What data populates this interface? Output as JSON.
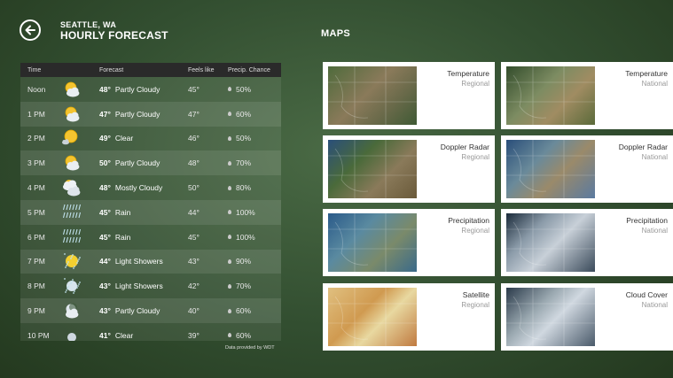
{
  "header": {
    "city": "SEATTLE, WA",
    "title": "HOURLY FORECAST",
    "maps_title": "MAPS"
  },
  "table": {
    "columns": [
      "Time",
      "Forecast",
      "Feels like",
      "Precip. Chance"
    ],
    "rows": [
      {
        "time": "Noon",
        "temp": "48°",
        "condition": "Partly Cloudy",
        "feels": "45°",
        "precip": "50%",
        "icon": "partly-cloudy-icon"
      },
      {
        "time": "1 PM",
        "temp": "47°",
        "condition": "Partly Cloudy",
        "feels": "47°",
        "precip": "60%",
        "icon": "partly-cloudy-icon"
      },
      {
        "time": "2 PM",
        "temp": "49°",
        "condition": "Clear",
        "feels": "46°",
        "precip": "50%",
        "icon": "clear-icon"
      },
      {
        "time": "3 PM",
        "temp": "50°",
        "condition": "Partly Cloudy",
        "feels": "48°",
        "precip": "70%",
        "icon": "partly-cloudy-icon"
      },
      {
        "time": "4 PM",
        "temp": "48°",
        "condition": "Mostly Cloudy",
        "feels": "50°",
        "precip": "80%",
        "icon": "mostly-cloudy-icon"
      },
      {
        "time": "5 PM",
        "temp": "45°",
        "condition": "Rain",
        "feels": "44°",
        "precip": "100%",
        "icon": "rain-icon"
      },
      {
        "time": "6 PM",
        "temp": "45°",
        "condition": "Rain",
        "feels": "45°",
        "precip": "100%",
        "icon": "rain-icon"
      },
      {
        "time": "7 PM",
        "temp": "44°",
        "condition": "Light Showers",
        "feels": "43°",
        "precip": "90%",
        "icon": "light-showers-icon"
      },
      {
        "time": "8 PM",
        "temp": "43°",
        "condition": "Light Showers",
        "feels": "42°",
        "precip": "70%",
        "icon": "light-showers-night-icon"
      },
      {
        "time": "9 PM",
        "temp": "43°",
        "condition": "Partly Cloudy",
        "feels": "40°",
        "precip": "60%",
        "icon": "partly-cloudy-night-icon"
      },
      {
        "time": "10 PM",
        "temp": "41°",
        "condition": "Clear",
        "feels": "39°",
        "precip": "60%",
        "icon": "clear-night-icon"
      }
    ]
  },
  "credit": "Data provided by WDT",
  "maps": [
    {
      "name": "Temperature",
      "scope": "Regional",
      "thumb": "regional-temp"
    },
    {
      "name": "Temperature",
      "scope": "National",
      "thumb": "national-temp"
    },
    {
      "name": "Doppler Radar",
      "scope": "Regional",
      "thumb": "regional-radar"
    },
    {
      "name": "Doppler Radar",
      "scope": "National",
      "thumb": "national-radar"
    },
    {
      "name": "Precipitation",
      "scope": "Regional",
      "thumb": "regional-precip"
    },
    {
      "name": "Precipitation",
      "scope": "National",
      "thumb": "national-precip"
    },
    {
      "name": "Satellite",
      "scope": "Regional",
      "thumb": "regional-satellite"
    },
    {
      "name": "Cloud Cover",
      "scope": "National",
      "thumb": "national-cloud"
    }
  ]
}
